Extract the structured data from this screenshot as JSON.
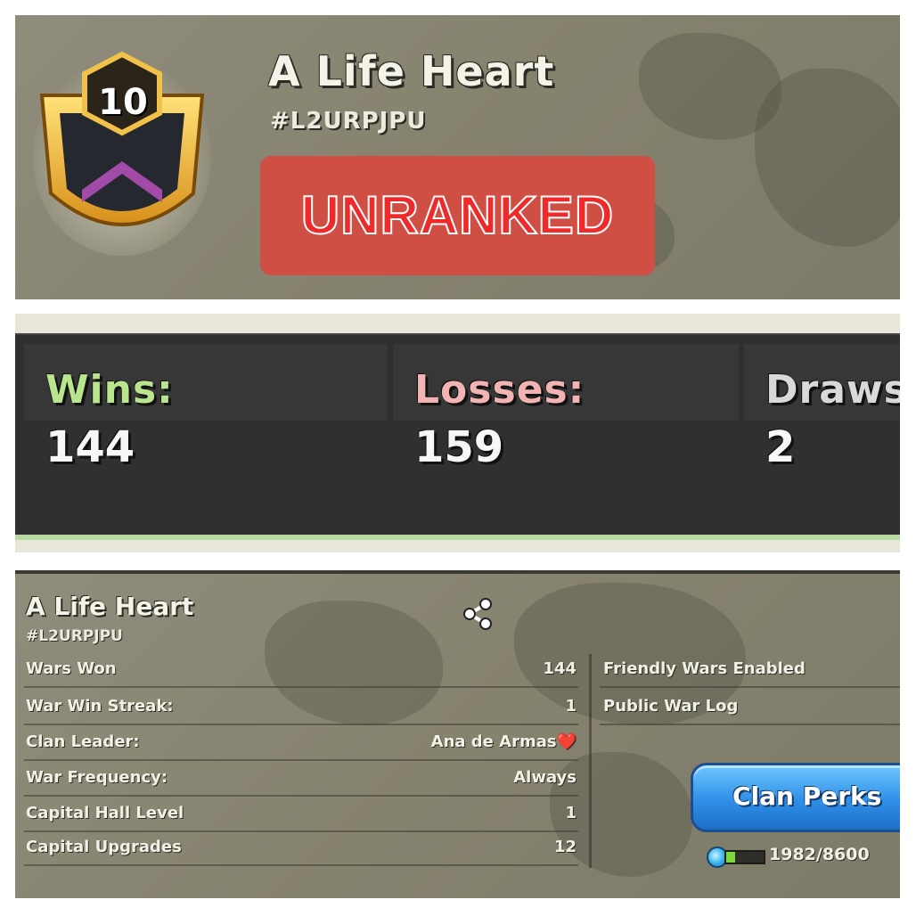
{
  "top": {
    "clan_level": "10",
    "clan_name": "A Life Heart",
    "clan_tag": "#L2URPJPU",
    "rank_text": "UNRANKED"
  },
  "war_record": {
    "wins_label": "Wins:",
    "wins": "144",
    "losses_label": "Losses:",
    "losses": "159",
    "draws_label": "Draws:",
    "draws": "2",
    "colors": {
      "wins": "#b9e58f",
      "losses": "#f2b3b3",
      "draws": "#d9d9d9"
    }
  },
  "clan_info": {
    "name": "A Life Heart",
    "tag": "#L2URPJPU",
    "rows": [
      {
        "label": "Wars Won",
        "value": "144"
      },
      {
        "label": "War Win Streak:",
        "value": "1"
      },
      {
        "label": "Clan Leader:",
        "value": "Ana de Armas❤️"
      },
      {
        "label": "War Frequency:",
        "value": "Always"
      },
      {
        "label": "Capital Hall Level",
        "value": "1"
      },
      {
        "label": "Capital Upgrades",
        "value": "12"
      }
    ],
    "right_rows": [
      "Friendly Wars Enabled",
      "Public War Log"
    ],
    "perks_button": "Clan Perks",
    "xp_text": "1982/8600",
    "xp_progress": 0.23,
    "icons": {
      "share": "share-icon",
      "xp": "clan-xp-orb-icon"
    }
  }
}
